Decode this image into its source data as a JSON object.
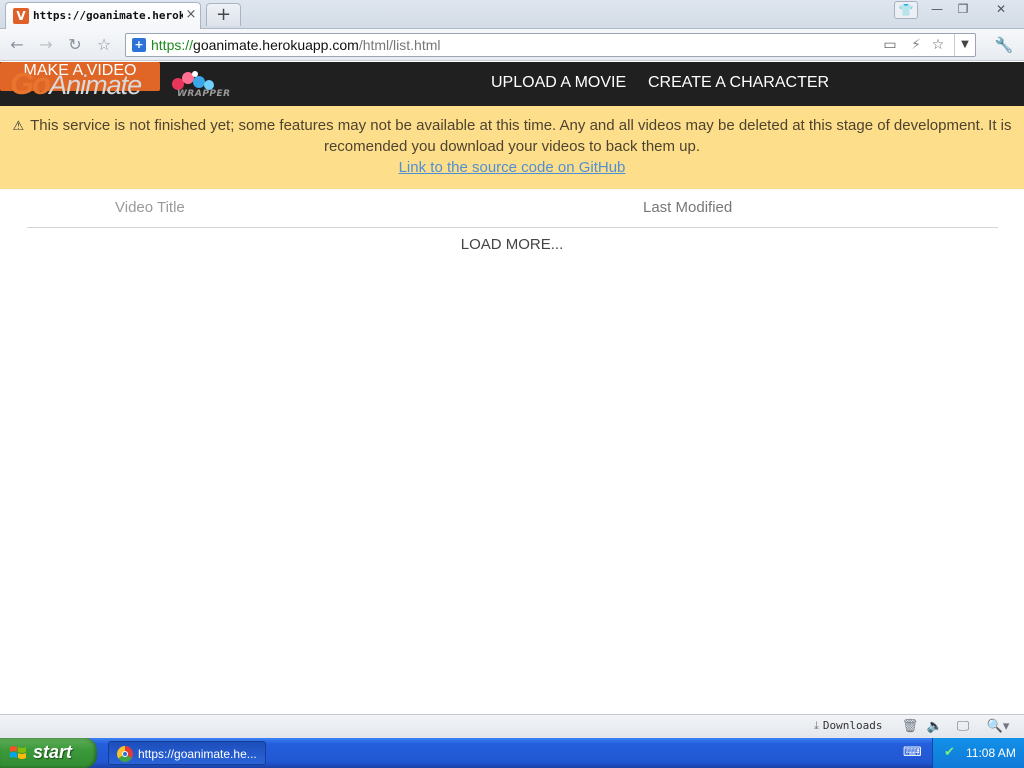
{
  "browser": {
    "tab_title": "https://goanimate.heroku",
    "tab_favicon_letter": "V",
    "tab_close": "×",
    "new_tab": "+",
    "window_buttons": {
      "special": "👕",
      "minimize": "—",
      "maximize": "❐",
      "close": "✕"
    },
    "nav": {
      "back": "←",
      "forward": "→",
      "reload": "↻",
      "star": "☆"
    },
    "url": {
      "scheme": "https://",
      "host": "goanimate.herokuapp.com",
      "path": "/html/list.html"
    },
    "omnibox_icons": {
      "screen": "▭",
      "bolt": "⚡",
      "bookmark": "☆",
      "dropdown": "▼"
    },
    "wrench": "🔧"
  },
  "site": {
    "logo_go": "Go",
    "logo_animate": "Animate",
    "logo_wrapper": "WRAPPER",
    "nav": {
      "upload": "UPLOAD A MOVIE",
      "create": "CREATE A CHARACTER",
      "make": "MAKE A VIDEO"
    }
  },
  "notice": {
    "icon": "⚠",
    "line1": "This service is not finished yet; some features may not be available at this time. Any and all videos may be deleted at this stage of development. It is",
    "line2": "recomended you download your videos to back them up.",
    "link": "Link to the source code on GitHub"
  },
  "list": {
    "columns": {
      "title": "Video Title",
      "modified": "Last Modified"
    },
    "load_more": "LOAD MORE..."
  },
  "statusbar": {
    "downloads": "Downloads",
    "icons": {
      "downloads": "⤓",
      "trash": "🗑",
      "speaker": "🔈",
      "display": "🖵",
      "zoom": "🔍▾"
    }
  },
  "taskbar": {
    "start": "start",
    "task_label": "https://goanimate.he...",
    "keyboard_icon": "⌨",
    "tray_icon": "✔",
    "clock": "11:08 AM"
  }
}
